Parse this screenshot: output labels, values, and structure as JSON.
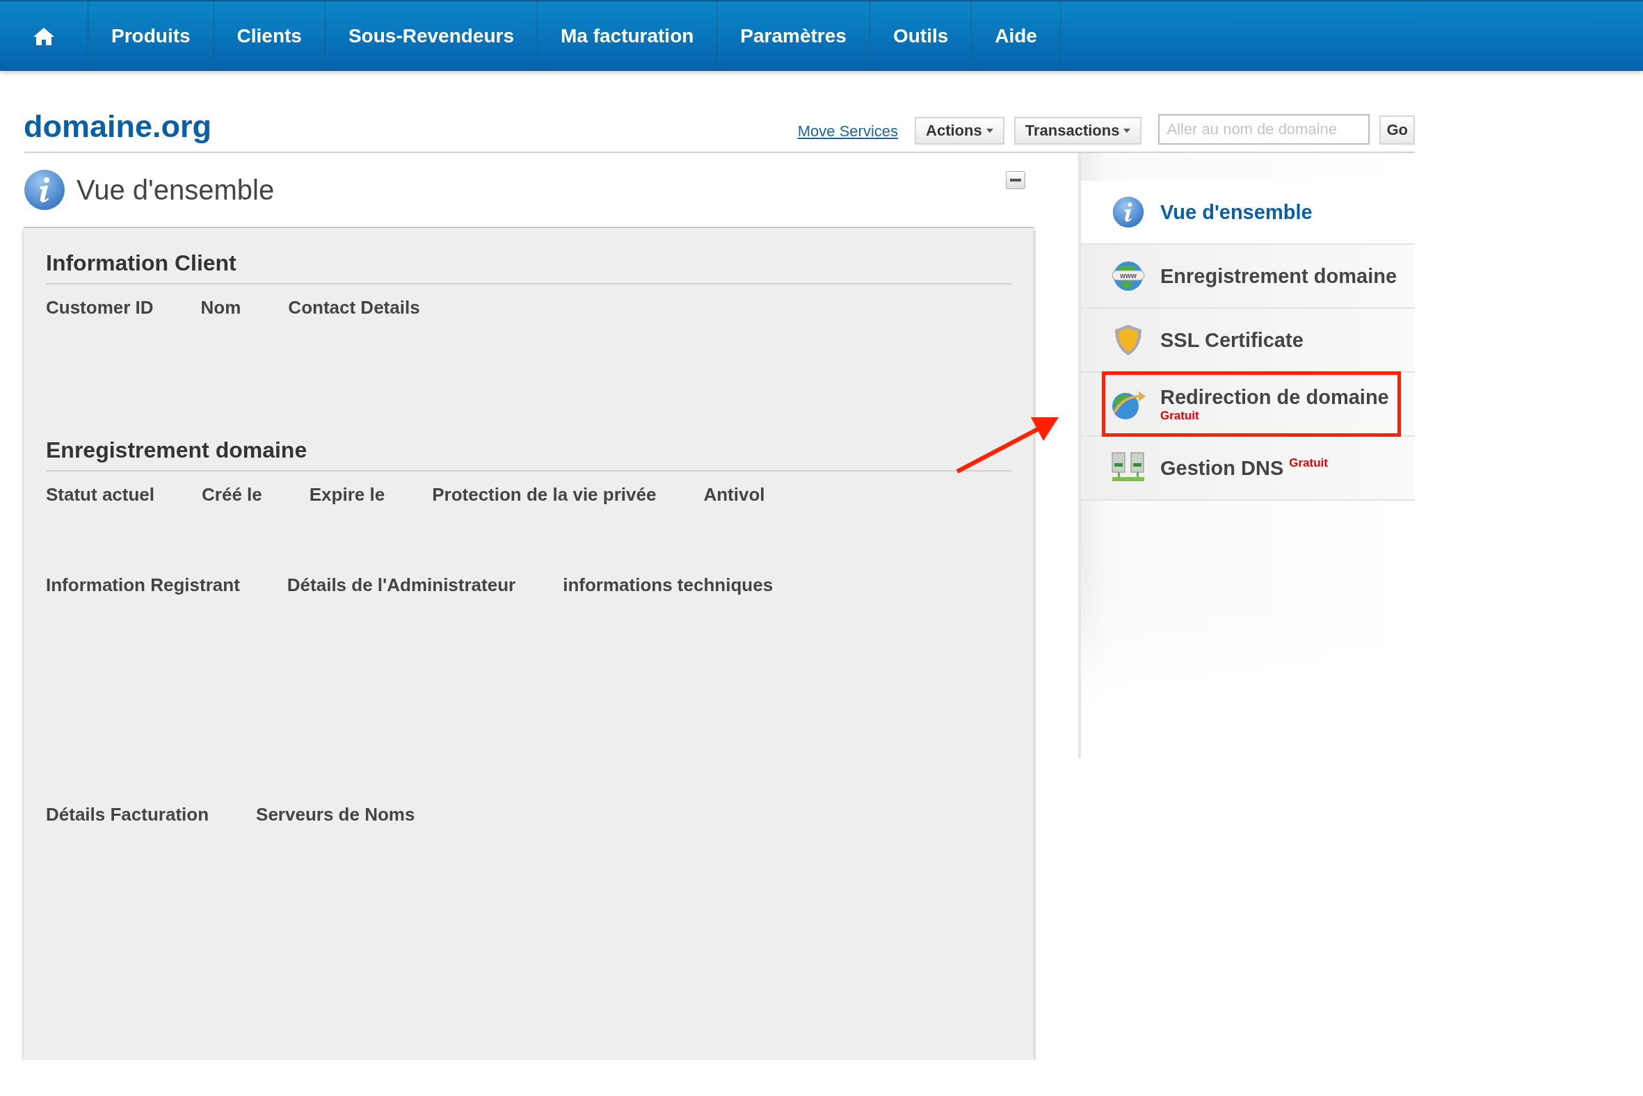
{
  "nav": {
    "items": [
      {
        "label": "Produits"
      },
      {
        "label": "Clients"
      },
      {
        "label": "Sous-Revendeurs"
      },
      {
        "label": "Ma facturation"
      },
      {
        "label": "Paramètres"
      },
      {
        "label": "Outils"
      },
      {
        "label": "Aide"
      }
    ]
  },
  "page_title": "domaine.org",
  "toolbar": {
    "link": "Move Services",
    "buttons": [
      "Actions",
      "Transactions"
    ],
    "search": {
      "placeholder": "Aller au nom de domaine"
    },
    "go": "Go"
  },
  "panel": {
    "title": "Vue d'ensemble",
    "sections": [
      {
        "heading": "Information Client",
        "field_groups": [
          {
            "fields": [
              {
                "label": "Customer ID"
              },
              {
                "label": "Nom"
              },
              {
                "label": "Contact Details"
              }
            ]
          }
        ]
      },
      {
        "heading": "Enregistrement domaine",
        "field_groups": [
          {
            "fields": [
              {
                "label": "Statut actuel"
              },
              {
                "label": "Créé le"
              },
              {
                "label": "Expire le"
              },
              {
                "label": "Protection de la vie privée"
              },
              {
                "label": "Antivol"
              }
            ]
          },
          {
            "fields": [
              {
                "label": "Information Registrant"
              },
              {
                "label": "Détails de l'Administrateur"
              },
              {
                "label": "informations techniques"
              }
            ]
          },
          {
            "fields": [
              {
                "label": "Détails Facturation"
              },
              {
                "label": "Serveurs de Noms"
              }
            ]
          }
        ]
      }
    ]
  },
  "sidebar": {
    "items": [
      {
        "kind": "info",
        "label": "Vue d'ensemble",
        "selected": true,
        "highlighted": false
      },
      {
        "kind": "www",
        "label": "Enregistrement domaine",
        "selected": false,
        "highlighted": false
      },
      {
        "kind": "shield",
        "label": "SSL Certificate",
        "selected": false,
        "highlighted": false
      },
      {
        "kind": "redirect",
        "label": "Redirection de domaine",
        "badge": "Gratuit",
        "badge_raised": false,
        "selected": false,
        "highlighted": true
      },
      {
        "kind": "servers",
        "label": "Gestion DNS",
        "badge": "Gratuit",
        "badge_raised": true,
        "selected": false,
        "highlighted": false
      }
    ]
  }
}
